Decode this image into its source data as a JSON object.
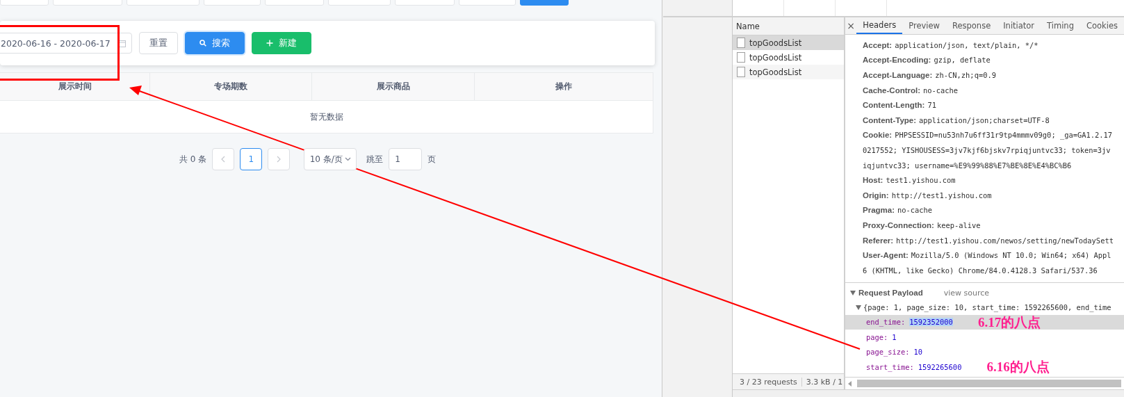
{
  "filter": {
    "date_range": "2020-06-16 - 2020-06-17",
    "buttons": [
      {
        "label": "重置",
        "kind": "default"
      },
      {
        "label": "搜索",
        "kind": "primary"
      },
      {
        "label": "新建",
        "kind": "success"
      }
    ]
  },
  "table": {
    "columns": [
      "展示时间",
      "专场期数",
      "展示商品",
      "操作"
    ],
    "empty_text": "暂无数据"
  },
  "pagination": {
    "total": "共 0 条",
    "pages": [
      {
        "label": "1",
        "selected": true
      }
    ],
    "page_size": "10 条/页",
    "jump_label": "跳至",
    "jump_value": "1",
    "page_suffix": "页"
  },
  "devtools": {
    "requests_header": "Name",
    "requests": [
      {
        "name": "topGoodsList",
        "selected": true
      },
      {
        "name": "topGoodsList",
        "selected": false
      },
      {
        "name": "topGoodsList",
        "selected": false
      }
    ],
    "close_label": "×",
    "tabs": [
      {
        "label": "Headers",
        "selected": true
      },
      {
        "label": "Preview",
        "selected": false
      },
      {
        "label": "Response",
        "selected": false
      },
      {
        "label": "Initiator",
        "selected": false
      },
      {
        "label": "Timing",
        "selected": false
      },
      {
        "label": "Cookies",
        "selected": false
      }
    ],
    "headers": [
      {
        "name": "Accept:",
        "value_lines": [
          "application/json, text/plain, */*"
        ]
      },
      {
        "name": "Accept-Encoding:",
        "value_lines": [
          "gzip, deflate"
        ]
      },
      {
        "name": "Accept-Language:",
        "value_lines": [
          "zh-CN,zh;q=0.9"
        ]
      },
      {
        "name": "Cache-Control:",
        "value_lines": [
          "no-cache"
        ]
      },
      {
        "name": "Content-Length:",
        "value_lines": [
          "71"
        ]
      },
      {
        "name": "Content-Type:",
        "value_lines": [
          "application/json;charset=UTF-8"
        ]
      },
      {
        "name": "Cookie:",
        "value_lines": [
          "PHPSESSID=nu53nh7u6ff31r9tp4mmmv09g0; _ga=GA1.2.17",
          "0217552; YISHOUSESS=3jv7kjf6bjskv7rpiqjuntvc33; token=3jv",
          "iqjuntvc33; username=%E9%99%88%E7%BE%8E%E4%BC%B6"
        ]
      },
      {
        "name": "Host:",
        "value_lines": [
          "test1.yishou.com"
        ]
      },
      {
        "name": "Origin:",
        "value_lines": [
          "http://test1.yishou.com"
        ]
      },
      {
        "name": "Pragma:",
        "value_lines": [
          "no-cache"
        ]
      },
      {
        "name": "Proxy-Connection:",
        "value_lines": [
          "keep-alive"
        ]
      },
      {
        "name": "Referer:",
        "value_lines": [
          "http://test1.yishou.com/newos/setting/newTodaySett"
        ]
      },
      {
        "name": "User-Agent:",
        "value_lines": [
          "Mozilla/5.0 (Windows NT 10.0; Win64; x64) Appl",
          "6 (KHTML, like Gecko) Chrome/84.0.4128.3 Safari/537.36"
        ]
      }
    ],
    "payload": {
      "title": "Request Payload",
      "view_source": "view source",
      "summary": "{page: 1, page_size: 10, start_time: 1592265600, end_time",
      "entries": [
        {
          "key": "end_time:",
          "value": "1592352000",
          "selected": true,
          "note": "6.17的八点"
        },
        {
          "key": "page:",
          "value": "1",
          "selected": false
        },
        {
          "key": "page_size:",
          "value": "10",
          "selected": false
        },
        {
          "key": "start_time:",
          "value": "1592265600",
          "selected": false,
          "note": "6.16的八点"
        }
      ]
    },
    "status": {
      "requests": "3 / 23 requests",
      "transferred": "3.3 kB / 1"
    }
  }
}
